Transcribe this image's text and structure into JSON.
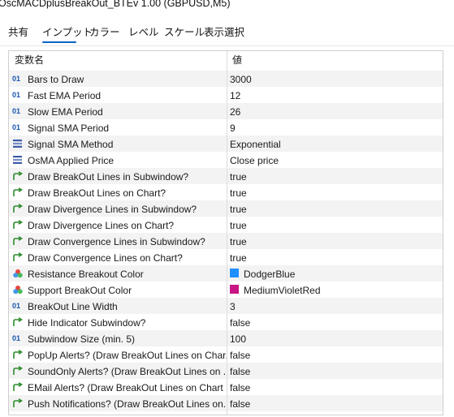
{
  "window": {
    "title": "OscMACDplusBreakOut_BTEv 1.00 (GBPUSD,M5)"
  },
  "tabs": [
    {
      "label": "共有",
      "active": false
    },
    {
      "label": "インプット",
      "active": true
    },
    {
      "label": "カラー",
      "active": false
    },
    {
      "label": "レベル",
      "active": false
    },
    {
      "label": "スケール",
      "active": false
    },
    {
      "label": "表示選択",
      "active": false
    }
  ],
  "grid": {
    "headers": {
      "name": "変数名",
      "value": "値"
    },
    "rows": [
      {
        "icon": "int-icon",
        "name": "Bars to Draw",
        "value": "3000"
      },
      {
        "icon": "int-icon",
        "name": "Fast EMA Period",
        "value": "12"
      },
      {
        "icon": "int-icon",
        "name": "Slow EMA Period",
        "value": "26"
      },
      {
        "icon": "int-icon",
        "name": "Signal SMA Period",
        "value": "9"
      },
      {
        "icon": "enum-icon",
        "name": "Signal SMA Method",
        "value": "Exponential"
      },
      {
        "icon": "enum-icon",
        "name": "OsMA Applied Price",
        "value": "Close price"
      },
      {
        "icon": "bool-icon",
        "name": "Draw BreakOut Lines in Subwindow?",
        "value": "true"
      },
      {
        "icon": "bool-icon",
        "name": "Draw BreakOut Lines on Chart?",
        "value": "true"
      },
      {
        "icon": "bool-icon",
        "name": "Draw Divergence Lines in Subwindow?",
        "value": "true"
      },
      {
        "icon": "bool-icon",
        "name": "Draw Divergence Lines on Chart?",
        "value": "true"
      },
      {
        "icon": "bool-icon",
        "name": "Draw Convergence Lines in Subwindow?",
        "value": "true"
      },
      {
        "icon": "bool-icon",
        "name": "Draw Convergence Lines on Chart?",
        "value": "true"
      },
      {
        "icon": "color-icon",
        "name": "Resistance Breakout Color",
        "value": "DodgerBlue",
        "swatch": "#1e90ff"
      },
      {
        "icon": "color-icon",
        "name": "Support BreakOut Color",
        "value": "MediumVioletRed",
        "swatch": "#c71585"
      },
      {
        "icon": "int-icon",
        "name": "BreakOut Line Width",
        "value": "3"
      },
      {
        "icon": "bool-icon",
        "name": "Hide Indicator Subwindow?",
        "value": "false"
      },
      {
        "icon": "int-icon",
        "name": "Subwindow Size (min. 5)",
        "value": "100"
      },
      {
        "icon": "bool-icon",
        "name": "PopUp Alerts? (Draw BreakOut Lines on Char...",
        "value": "false"
      },
      {
        "icon": "bool-icon",
        "name": "SoundOnly Alerts? (Draw BreakOut Lines on ...",
        "value": "false"
      },
      {
        "icon": "bool-icon",
        "name": "EMail Alerts? (Draw BreakOut Lines on Chart ...",
        "value": "false"
      },
      {
        "icon": "bool-icon",
        "name": "Push Notifications? (Draw BreakOut Lines on...",
        "value": "false"
      }
    ]
  },
  "icons": {
    "int-icon": "01",
    "colors": {
      "int": "#1a56b0",
      "bool": "#2e8b2e",
      "enum": "#3b5ba8",
      "accent": "#0a64c8"
    }
  }
}
